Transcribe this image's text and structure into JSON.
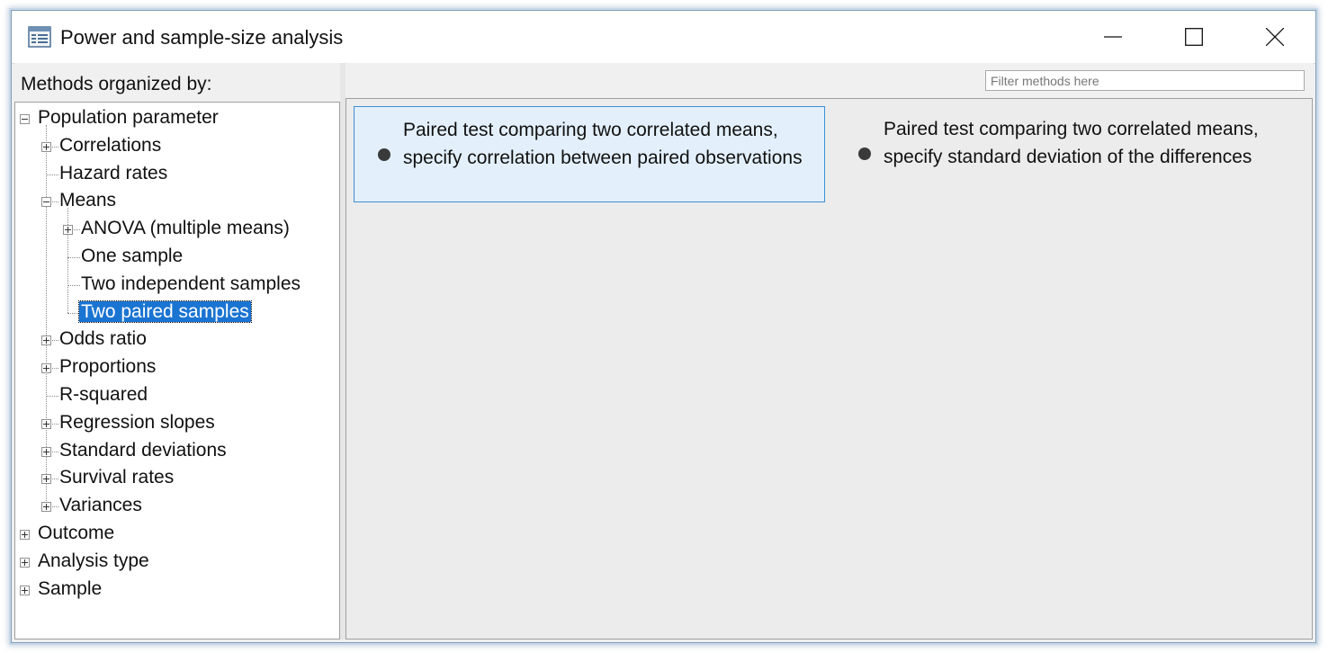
{
  "window": {
    "title": "Power and sample-size analysis",
    "buttons": {
      "minimize": "minimize",
      "maximize": "maximize",
      "close": "close"
    }
  },
  "left_pane": {
    "header": "Methods organized by:",
    "tree": [
      {
        "label": "Population parameter",
        "level": 0,
        "expander": "minus"
      },
      {
        "label": "Correlations",
        "level": 1,
        "expander": "plus"
      },
      {
        "label": "Hazard rates",
        "level": 1,
        "expander": "none"
      },
      {
        "label": "Means",
        "level": 1,
        "expander": "minus"
      },
      {
        "label": "ANOVA (multiple means)",
        "level": 2,
        "expander": "plus"
      },
      {
        "label": "One sample",
        "level": 2,
        "expander": "none"
      },
      {
        "label": "Two independent samples",
        "level": 2,
        "expander": "none"
      },
      {
        "label": "Two paired samples",
        "level": 2,
        "expander": "none",
        "selected": true
      },
      {
        "label": "Odds ratio",
        "level": 1,
        "expander": "plus"
      },
      {
        "label": "Proportions",
        "level": 1,
        "expander": "plus"
      },
      {
        "label": "R-squared",
        "level": 1,
        "expander": "none"
      },
      {
        "label": "Regression slopes",
        "level": 1,
        "expander": "plus"
      },
      {
        "label": "Standard deviations",
        "level": 1,
        "expander": "plus"
      },
      {
        "label": "Survival rates",
        "level": 1,
        "expander": "plus"
      },
      {
        "label": "Variances",
        "level": 1,
        "expander": "plus"
      },
      {
        "label": "Outcome",
        "level": 0,
        "expander": "plus"
      },
      {
        "label": "Analysis type",
        "level": 0,
        "expander": "plus"
      },
      {
        "label": "Sample",
        "level": 0,
        "expander": "plus"
      }
    ]
  },
  "right_pane": {
    "filter_placeholder": "Filter methods here",
    "methods": [
      {
        "text": "Paired test comparing two correlated means, specify correlation between paired observations",
        "selected": true
      },
      {
        "text": "Paired test comparing two correlated means, specify standard deviation of the differences",
        "selected": false
      }
    ]
  },
  "colors": {
    "selection": "#1a74d2",
    "method_highlight_bg": "#e3f0fb",
    "method_highlight_border": "#3c8fd6"
  },
  "icons": [
    "app-window-icon",
    "minimize-icon",
    "maximize-icon",
    "close-icon",
    "bullet-icon",
    "expander-plus-icon",
    "expander-minus-icon"
  ]
}
